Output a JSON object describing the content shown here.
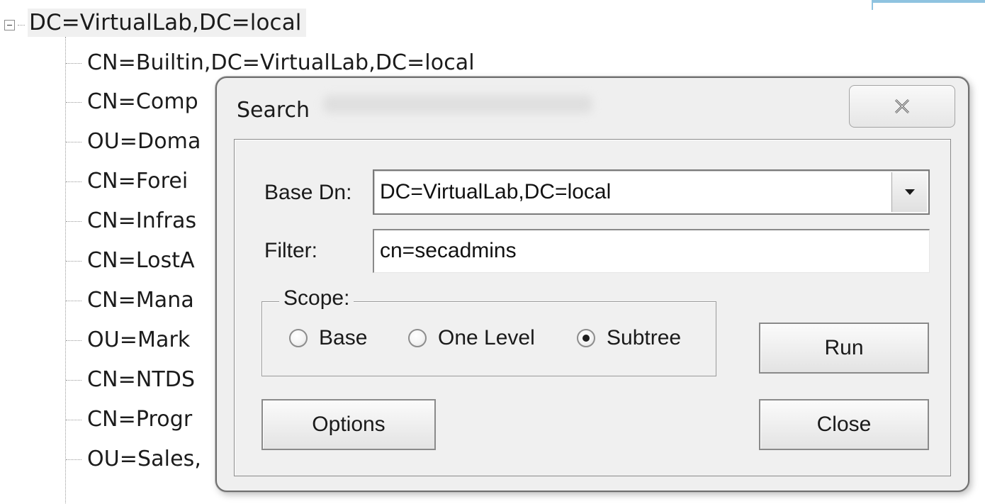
{
  "tree": {
    "root_label": "DC=VirtualLab,DC=local",
    "children": [
      "CN=Builtin,DC=VirtualLab,DC=local",
      "CN=Comp",
      "OU=Doma",
      "CN=Forei",
      "CN=Infras",
      "CN=LostA",
      "CN=Mana",
      "OU=Mark",
      "CN=NTDS",
      "CN=Progr",
      "OU=Sales,"
    ]
  },
  "dialog": {
    "title": "Search",
    "close_icon": "close-x-icon",
    "base_dn": {
      "label": "Base Dn:",
      "value": "DC=VirtualLab,DC=local",
      "dropdown_icon": "dropdown-arrow-icon"
    },
    "filter": {
      "label": "Filter:",
      "value": "cn=secadmins"
    },
    "scope": {
      "legend": "Scope:",
      "options": [
        {
          "label": "Base",
          "checked": false
        },
        {
          "label": "One Level",
          "checked": false
        },
        {
          "label": "Subtree",
          "checked": true
        }
      ]
    },
    "buttons": {
      "run": "Run",
      "options": "Options",
      "close": "Close"
    }
  },
  "colors": {
    "dialog_background": "#efefef",
    "tree_selected_background": "#f0f0f0",
    "accent": "#8fc3e0"
  }
}
